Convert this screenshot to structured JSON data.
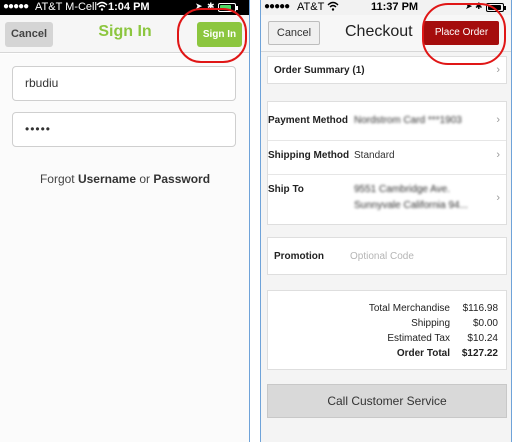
{
  "left": {
    "status": {
      "dots": "●●●●●",
      "carrier": "AT&T M-Cell",
      "time": "1:04 PM",
      "battery_fill": 0.8,
      "battery_color": "#4cd964"
    },
    "nav": {
      "cancel_label": "Cancel",
      "title": "Sign In",
      "signin_label": "Sign In"
    },
    "form": {
      "username_value": "rbudiu",
      "password_value": "•••••"
    },
    "forgot": {
      "prefix": "Forgot",
      "username_link": "Username",
      "or": "or",
      "password_link": "Password"
    },
    "colors": {
      "accent": "#8cc63f"
    }
  },
  "right": {
    "status": {
      "dots": "●●●●●",
      "carrier": "AT&T",
      "time": "11:37 PM",
      "battery_fill": 0.9,
      "battery_color": "#000000"
    },
    "nav": {
      "cancel_label": "Cancel",
      "title": "Checkout",
      "place_order_label": "Place Order"
    },
    "order_summary": {
      "label": "Order Summary (1)"
    },
    "payment": {
      "label": "Payment Method",
      "value": "Nordstrom Card ***1903"
    },
    "shipping": {
      "label": "Shipping Method",
      "value": "Standard"
    },
    "ship_to": {
      "label": "Ship To",
      "line1": "9551 Cambridge Ave.",
      "line2": "Sunnyvale California 94..."
    },
    "promotion": {
      "label": "Promotion",
      "placeholder": "Optional Code"
    },
    "totals": {
      "merch_label": "Total Merchandise",
      "merch_value": "$116.98",
      "shipping_label": "Shipping",
      "shipping_value": "$0.00",
      "tax_label": "Estimated Tax",
      "tax_value": "$10.24",
      "order_total_label": "Order Total",
      "order_total_value": "$127.22"
    },
    "call_button": "Call Customer Service",
    "colors": {
      "place_order": "#a50d0d"
    }
  },
  "highlight_color": "#e01616"
}
